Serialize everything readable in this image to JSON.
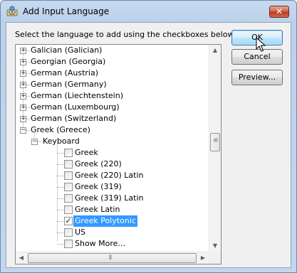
{
  "window": {
    "title": "Add Input Language",
    "close_glyph": "✕",
    "title_icon": "keyboard-language-icon"
  },
  "instruction": "Select the language to add using the checkboxes below.",
  "buttons": {
    "ok": "OK",
    "cancel": "Cancel",
    "preview": "Preview..."
  },
  "tree": {
    "languages": [
      {
        "label": "Galician (Galician)",
        "expanded": false
      },
      {
        "label": "Georgian (Georgia)",
        "expanded": false
      },
      {
        "label": "German (Austria)",
        "expanded": false
      },
      {
        "label": "German (Germany)",
        "expanded": false
      },
      {
        "label": "German (Liechtenstein)",
        "expanded": false
      },
      {
        "label": "German (Luxembourg)",
        "expanded": false
      },
      {
        "label": "German (Switzerland)",
        "expanded": false
      },
      {
        "label": "Greek (Greece)",
        "expanded": true
      }
    ],
    "group": {
      "label": "Keyboard",
      "expanded": true
    },
    "keyboards": [
      {
        "label": "Greek",
        "checked": false,
        "selected": false
      },
      {
        "label": "Greek (220)",
        "checked": false,
        "selected": false
      },
      {
        "label": "Greek (220) Latin",
        "checked": false,
        "selected": false
      },
      {
        "label": "Greek (319)",
        "checked": false,
        "selected": false
      },
      {
        "label": "Greek (319) Latin",
        "checked": false,
        "selected": false
      },
      {
        "label": "Greek Latin",
        "checked": false,
        "selected": false
      },
      {
        "label": "Greek Polytonic",
        "checked": true,
        "selected": true
      },
      {
        "label": "US",
        "checked": false,
        "selected": false
      },
      {
        "label": "Show More...",
        "checked": false,
        "selected": false
      }
    ],
    "expand_glyph": "+",
    "collapse_glyph": "−",
    "check_glyph": "✓"
  },
  "colors": {
    "selection": "#3399ff",
    "ok_border": "#3c7fb1",
    "close_red": "#c8462b"
  }
}
